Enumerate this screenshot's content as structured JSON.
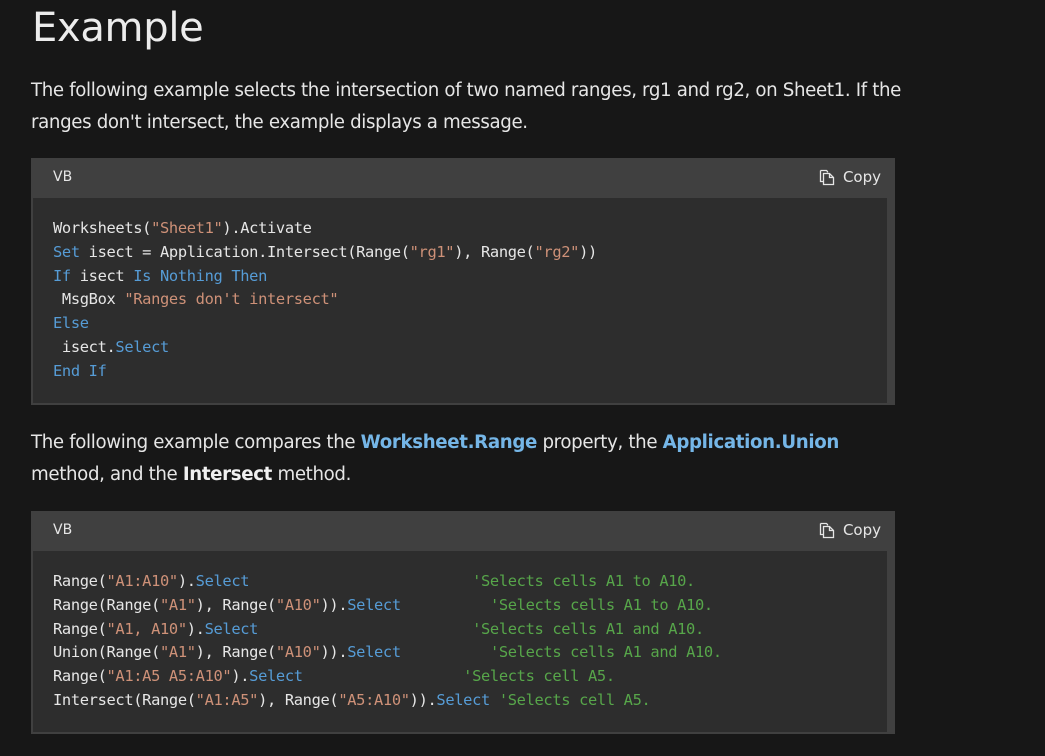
{
  "heading": "Example",
  "paragraph1": "The following example selects the intersection of two named ranges, rg1 and rg2, on Sheet1. If the ranges don't intersect, the example displays a message.",
  "paragraph2": {
    "part1": "The following example compares the ",
    "link1": "Worksheet.Range",
    "part2": " property, the ",
    "link2": "Application.Union",
    "part3": " method, and the ",
    "strong": "Intersect",
    "part4": " method."
  },
  "code_blocks": [
    {
      "language": "VB",
      "copy_label": "Copy",
      "copy_icon": "copy-icon",
      "lines": [
        [
          {
            "t": "tx",
            "v": "Worksheets("
          },
          {
            "t": "str",
            "v": "\"Sheet1\""
          },
          {
            "t": "tx",
            "v": ").Activate"
          }
        ],
        [
          {
            "t": "kw",
            "v": "Set"
          },
          {
            "t": "tx",
            "v": " isect = Application.Intersect(Range("
          },
          {
            "t": "str",
            "v": "\"rg1\""
          },
          {
            "t": "tx",
            "v": "), Range("
          },
          {
            "t": "str",
            "v": "\"rg2\""
          },
          {
            "t": "tx",
            "v": "))"
          }
        ],
        [
          {
            "t": "kw",
            "v": "If"
          },
          {
            "t": "tx",
            "v": " isect "
          },
          {
            "t": "kw",
            "v": "Is Nothing Then"
          }
        ],
        [
          {
            "t": "tx",
            "v": " MsgBox "
          },
          {
            "t": "str",
            "v": "\"Ranges don't intersect\""
          }
        ],
        [
          {
            "t": "kw",
            "v": "Else"
          }
        ],
        [
          {
            "t": "tx",
            "v": " isect."
          },
          {
            "t": "kw",
            "v": "Select"
          }
        ],
        [
          {
            "t": "kw",
            "v": "End If"
          }
        ]
      ]
    },
    {
      "language": "VB",
      "copy_label": "Copy",
      "copy_icon": "copy-icon",
      "lines": [
        [
          {
            "t": "tx",
            "v": "Range("
          },
          {
            "t": "str",
            "v": "\"A1:A10\""
          },
          {
            "t": "tx",
            "v": ")."
          },
          {
            "t": "kw",
            "v": "Select"
          },
          {
            "t": "tx",
            "v": "                         "
          },
          {
            "t": "cm",
            "v": "'Selects cells A1 to A10."
          }
        ],
        [
          {
            "t": "tx",
            "v": "Range(Range("
          },
          {
            "t": "str",
            "v": "\"A1\""
          },
          {
            "t": "tx",
            "v": "), Range("
          },
          {
            "t": "str",
            "v": "\"A10\""
          },
          {
            "t": "tx",
            "v": "))."
          },
          {
            "t": "kw",
            "v": "Select"
          },
          {
            "t": "tx",
            "v": "          "
          },
          {
            "t": "cm",
            "v": "'Selects cells A1 to A10."
          }
        ],
        [
          {
            "t": "tx",
            "v": "Range("
          },
          {
            "t": "str",
            "v": "\"A1, A10\""
          },
          {
            "t": "tx",
            "v": ")."
          },
          {
            "t": "kw",
            "v": "Select"
          },
          {
            "t": "tx",
            "v": "                        "
          },
          {
            "t": "cm",
            "v": "'Selects cells A1 and A10."
          }
        ],
        [
          {
            "t": "tx",
            "v": "Union(Range("
          },
          {
            "t": "str",
            "v": "\"A1\""
          },
          {
            "t": "tx",
            "v": "), Range("
          },
          {
            "t": "str",
            "v": "\"A10\""
          },
          {
            "t": "tx",
            "v": "))."
          },
          {
            "t": "kw",
            "v": "Select"
          },
          {
            "t": "tx",
            "v": "          "
          },
          {
            "t": "cm",
            "v": "'Selects cells A1 and A10."
          }
        ],
        [
          {
            "t": "tx",
            "v": "Range("
          },
          {
            "t": "str",
            "v": "\"A1:A5 A5:A10\""
          },
          {
            "t": "tx",
            "v": ")."
          },
          {
            "t": "kw",
            "v": "Select"
          },
          {
            "t": "tx",
            "v": "                  "
          },
          {
            "t": "cm",
            "v": "'Selects cell A5."
          }
        ],
        [
          {
            "t": "tx",
            "v": "Intersect(Range("
          },
          {
            "t": "str",
            "v": "\"A1:A5\""
          },
          {
            "t": "tx",
            "v": "), Range("
          },
          {
            "t": "str",
            "v": "\"A5:A10\""
          },
          {
            "t": "tx",
            "v": "))."
          },
          {
            "t": "kw",
            "v": "Select"
          },
          {
            "t": "tx",
            "v": " "
          },
          {
            "t": "cm",
            "v": "'Selects cell A5."
          }
        ]
      ]
    }
  ],
  "colors": {
    "background": "#171717",
    "code_header": "#404040",
    "code_body": "#2d2d2d",
    "keyword": "#569cd6",
    "string": "#ce9178",
    "comment": "#57a64a",
    "link": "#75b6e7"
  }
}
